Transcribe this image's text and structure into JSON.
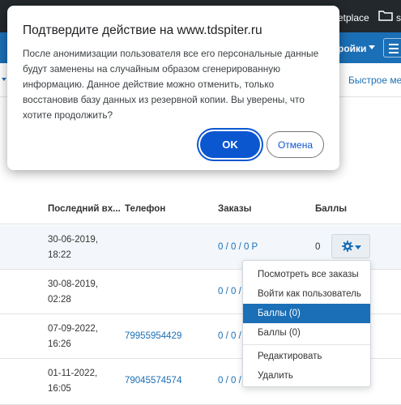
{
  "topbar": {
    "text": "etplace",
    "folder_text": "s"
  },
  "navbar": {
    "label": "ройки"
  },
  "subbar": {
    "quick_menu": "Быстрое меню"
  },
  "table": {
    "headers": {
      "last_login": "Последний вх...",
      "phone": "Телефон",
      "orders": "Заказы",
      "points": "Баллы"
    },
    "rows": [
      {
        "date": "30-06-2019,",
        "time": "18:22",
        "phone": "",
        "orders": "0 / 0 / 0 Р",
        "points": "0"
      },
      {
        "date": "30-08-2019,",
        "time": "02:28",
        "phone": "",
        "orders": "0 / 0 /",
        "points": ""
      },
      {
        "date": "07-09-2022,",
        "time": "16:26",
        "phone": "79955954429",
        "orders": "0 / 0 /",
        "points": ""
      },
      {
        "date": "01-11-2022,",
        "time": "16:05",
        "phone": "79045574574",
        "orders": "0 / 0 /",
        "points": ""
      }
    ]
  },
  "dropdown": {
    "items": [
      "Посмотреть все заказы",
      "Войти как пользователь",
      "Баллы (0)",
      "Баллы (0)",
      "Редактировать",
      "Удалить"
    ],
    "active_index": 2
  },
  "dialog": {
    "title": "Подтвердите действие на www.tdspiter.ru",
    "message": "После анонимизации пользователя все его персональные данные будут заменены на случайным образом сгенерированную информацию. Данное действие можно отменить, только восстановив базу данных из резервной копии. Вы уверены, что хотите продолжить?",
    "ok_label": "OK",
    "cancel_label": "Отмена"
  },
  "colors": {
    "accent": "#1b6fb6",
    "dialog_primary": "#0b57d0",
    "topbar": "#23282d"
  }
}
